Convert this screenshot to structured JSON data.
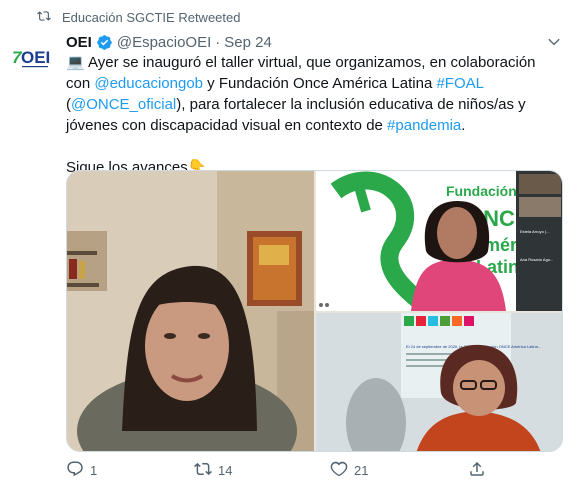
{
  "retweet_header": {
    "icon": "retweet-icon",
    "text": "Educación SGCTIE Retweeted"
  },
  "author": {
    "name": "OEI",
    "handle": "@EspacioOEI",
    "separator": "·",
    "date": "Sep 24",
    "avatar_text": "OEI"
  },
  "tweet": {
    "line1_emoji": "💻",
    "segments_p1": [
      {
        "text": " Ayer se inauguró el taller virtual, que organizamos, en colaboración con ",
        "link": false
      },
      {
        "text": "@educaciongob",
        "link": true
      },
      {
        "text": " y Fundación Once América Latina ",
        "link": false
      },
      {
        "text": "#FOAL",
        "link": true
      },
      {
        "text": " (",
        "link": false
      },
      {
        "text": "@ONCE_oficial",
        "link": true
      },
      {
        "text": "), para fortalecer la inclusión educativa de niños/as y jóvenes con discapacidad visual en contexto de ",
        "link": false
      },
      {
        "text": "#pandemia",
        "link": true
      },
      {
        "text": ".",
        "link": false
      }
    ],
    "p2": "Sigue los avances",
    "p2_emoji": "👇"
  },
  "media": {
    "banner_text": "Fundación ONCE América Latina",
    "slide_text": "El 24 de septiembre de 2020, la OEI y la Fundación ONCE América Latina...",
    "participant_1": "Estela Arroyo (...",
    "participant_2": "Ana Rosario Agu..."
  },
  "actions": {
    "reply": {
      "icon": "reply-icon",
      "count": "1"
    },
    "retweet": {
      "icon": "retweet-icon",
      "count": "14"
    },
    "like": {
      "icon": "heart-icon",
      "count": "21"
    },
    "share": {
      "icon": "share-icon"
    }
  },
  "colors": {
    "link": "#1d9bf0",
    "secondary": "#536471",
    "verified": "#1d9bf0",
    "oei_green": "#2aa84a",
    "oei_blue": "#1b3d8f"
  }
}
